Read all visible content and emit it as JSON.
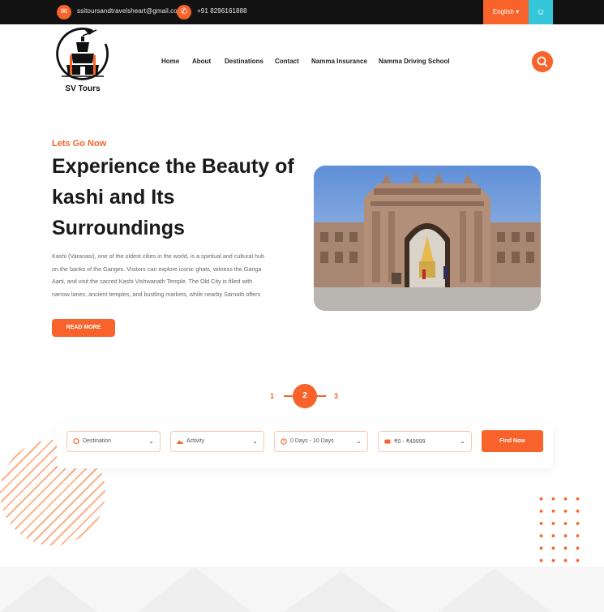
{
  "topbar": {
    "email": "ssitoursandtravelsheart@gmail.com",
    "phone": "+91 8296161888",
    "language": "English ▾"
  },
  "brand": {
    "name": "SV Tours"
  },
  "nav": {
    "items": [
      "Home",
      "About",
      "Destinations",
      "Contact",
      "Namma Insurance",
      "Namma Driving School"
    ]
  },
  "hero": {
    "eyebrow": "Lets Go Now",
    "title": "Experience the Beauty of kashi and Its Surroundings",
    "description": "Kashi (Varanasi), one of the oldest cities in the world, is a spiritual and cultural hub on the banks of the Ganges. Visitors can explore iconic ghats, witness the Ganga Aarti, and visit the sacred Kashi Vishwanath Temple. The Old City is filled with narrow lanes, ancient temples, and bustling markets, while nearby Sarnath offers",
    "read_more": "READ MORE"
  },
  "pagination": {
    "pages": [
      "1",
      "2",
      "3"
    ],
    "active": "2"
  },
  "search": {
    "destination": "Destination",
    "activity": "Activity",
    "duration": "0 Days - 10 Days",
    "price": "₹0 - ₹49999",
    "find_now": "Find Now"
  },
  "colors": {
    "accent": "#f7632a",
    "secondary": "#35c5d8",
    "topbar": "#121212"
  }
}
